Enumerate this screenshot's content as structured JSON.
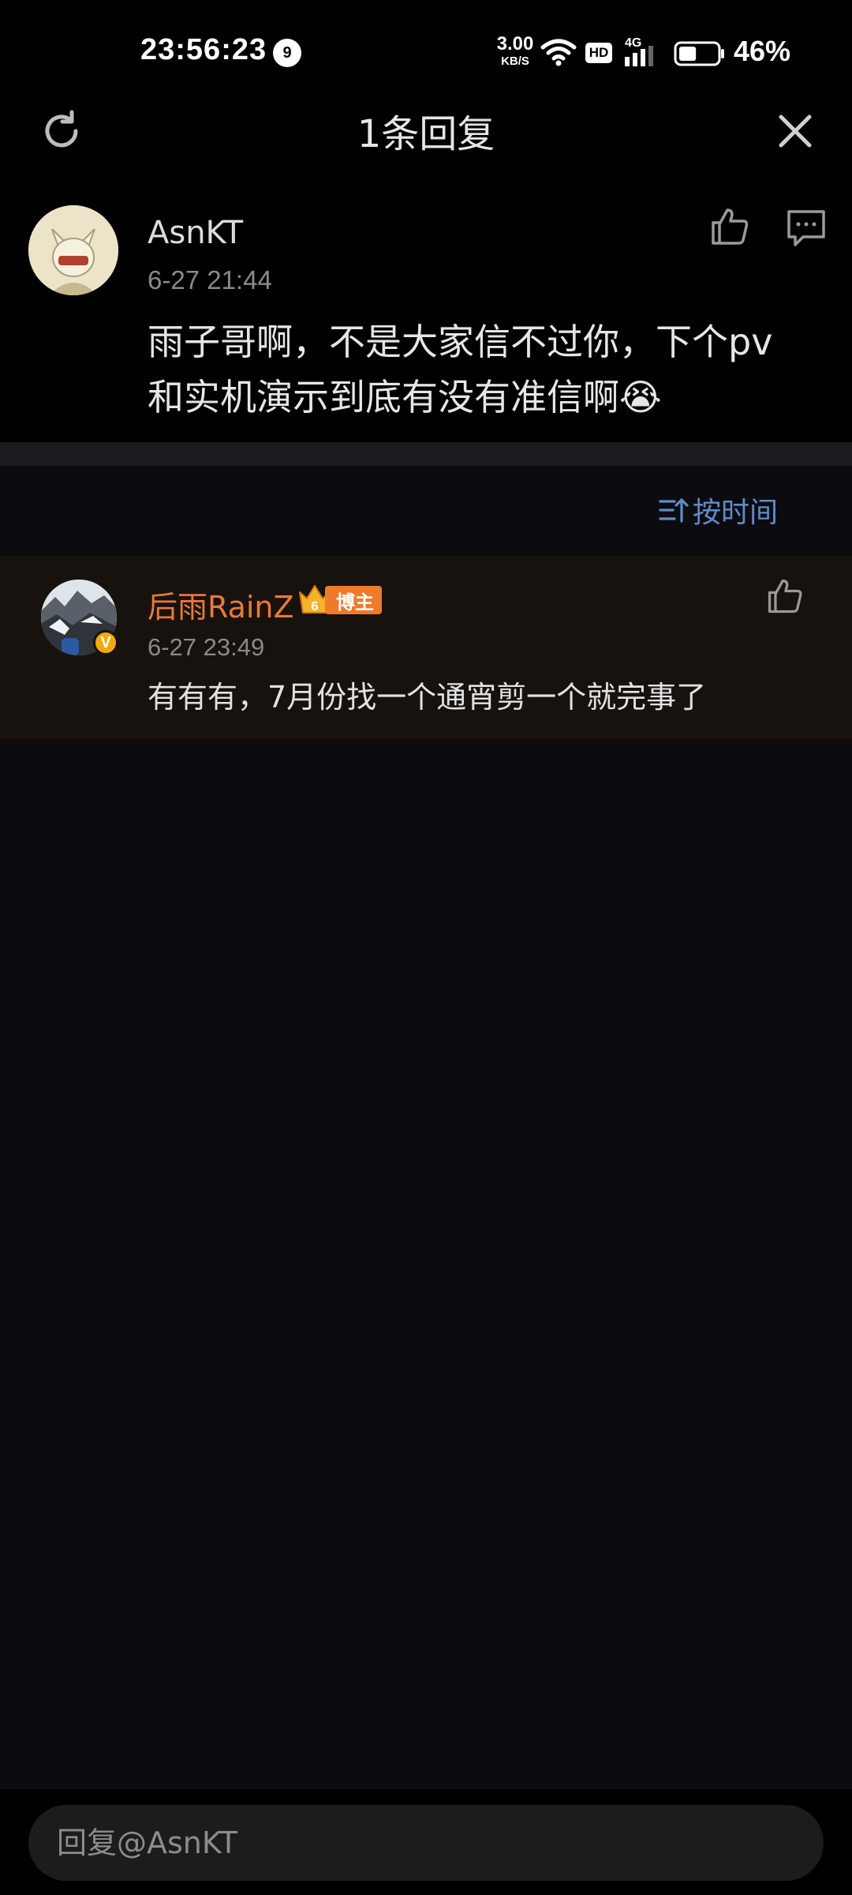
{
  "status_bar": {
    "time": "23:56:23",
    "notification_count": "9",
    "net_speed_value": "3.00",
    "net_speed_unit": "KB/S",
    "hd_label": "HD",
    "network_type": "4G",
    "battery_percent": "46%",
    "battery_level": 0.46
  },
  "header": {
    "title": "1条回复",
    "refresh_icon": "refresh-icon",
    "close_icon": "close-icon"
  },
  "main_comment": {
    "user_name": "AsnKT",
    "time": "6-27 21:44",
    "text": "雨子哥啊，不是大家信不过你，下个pv和实机演示到底有没有准信啊😭",
    "like_icon": "thumb-up-icon",
    "reply_icon": "comment-icon"
  },
  "sort": {
    "label": "按时间",
    "icon": "sort-time-icon"
  },
  "replies": [
    {
      "user_name": "后雨RainZ",
      "badge_level": "6",
      "badge_label": "博主",
      "verified": "V",
      "time": "6-27 23:49",
      "text": "有有有，7月份找一个通宵剪一个就完事了",
      "like_icon": "thumb-up-icon"
    }
  ],
  "reply_input": {
    "placeholder": "回复@AsnKT"
  },
  "colors": {
    "background": "#0c0c10",
    "author_name": "#e8793a",
    "sort_link": "#5f8cc8",
    "blogger_tag": "#ee7a2a",
    "verified": "#f2a90d"
  }
}
